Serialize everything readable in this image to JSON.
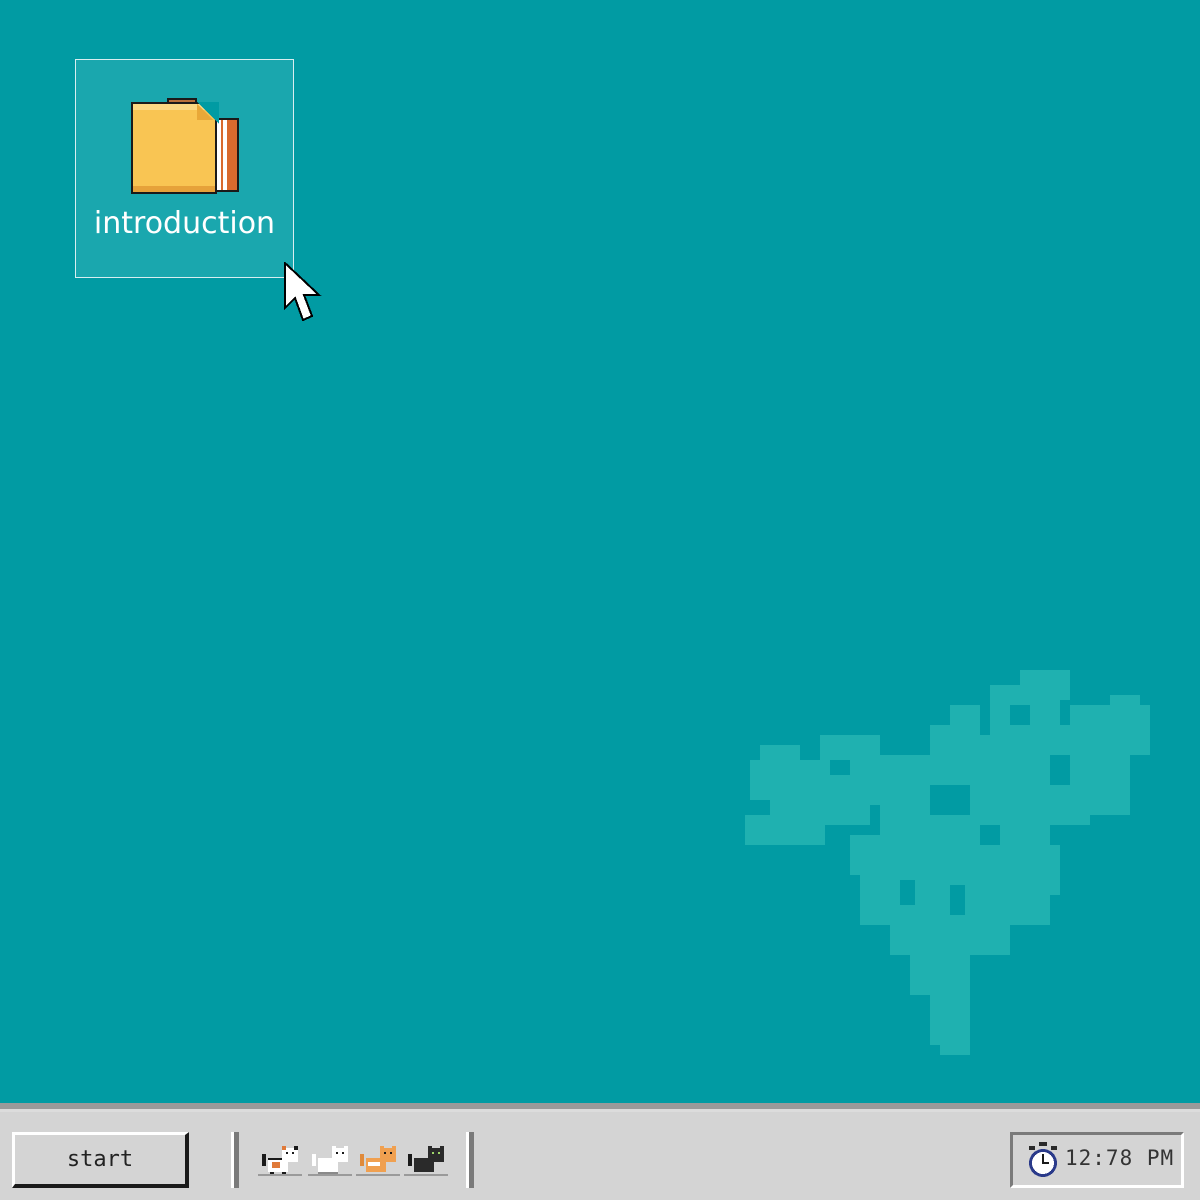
{
  "desktop": {
    "background_color": "#019ba3",
    "icons": [
      {
        "label": "introduction",
        "icon": "folder-icon",
        "selected": true
      }
    ]
  },
  "taskbar": {
    "start_label": "start",
    "quick_launch": [
      {
        "icon": "calico-cat-icon"
      },
      {
        "icon": "white-cat-icon"
      },
      {
        "icon": "orange-cat-icon"
      },
      {
        "icon": "black-cat-icon"
      }
    ],
    "clock": {
      "icon": "stopwatch-icon",
      "time": "12:78 PM"
    }
  },
  "colors": {
    "desktop": "#019ba3",
    "taskbar": "#d4d4d4",
    "folder": "#f9c553",
    "watermark": "#1fb1b0"
  }
}
